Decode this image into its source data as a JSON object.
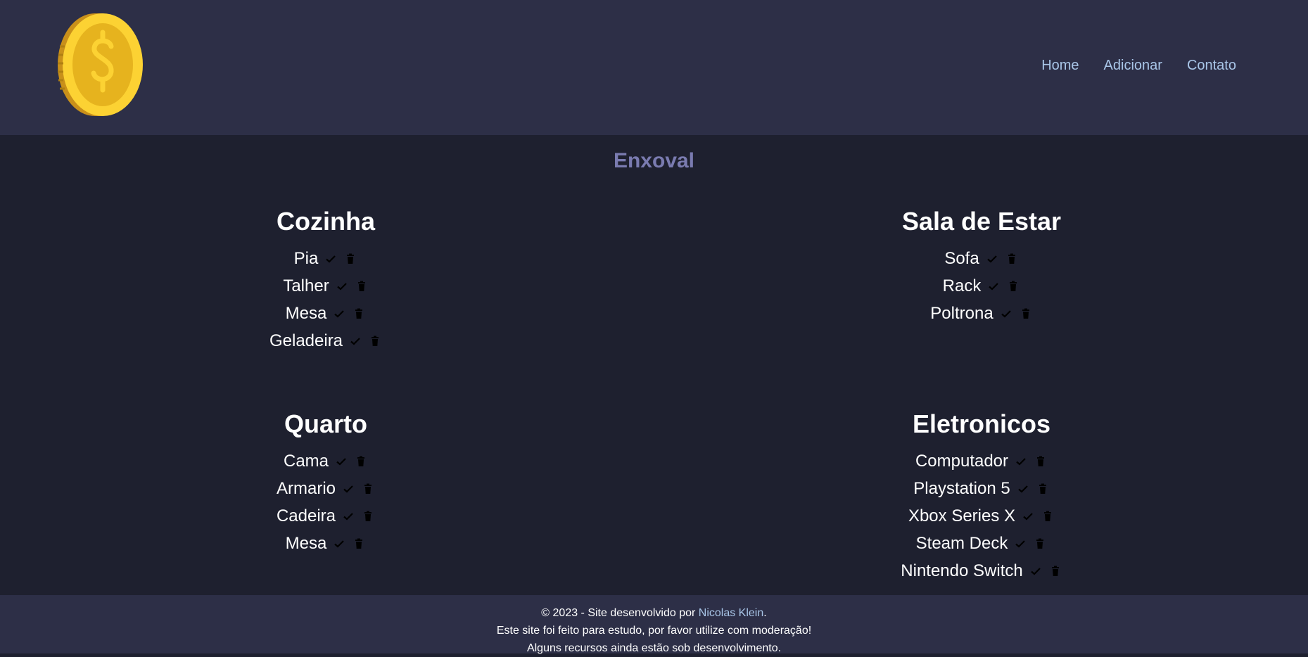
{
  "header": {
    "logo_icon": "coin-dollar-icon",
    "nav": [
      {
        "label": "Home"
      },
      {
        "label": "Adicionar"
      },
      {
        "label": "Contato"
      }
    ]
  },
  "main": {
    "title": "Enxoval",
    "categories": [
      {
        "name": "Cozinha",
        "items": [
          "Pia",
          "Talher",
          "Mesa",
          "Geladeira"
        ]
      },
      {
        "name": "Sala de Estar",
        "items": [
          "Sofa",
          "Rack",
          "Poltrona"
        ]
      },
      {
        "name": "Quarto",
        "items": [
          "Cama",
          "Armario",
          "Cadeira",
          "Mesa"
        ]
      },
      {
        "name": "Eletronicos",
        "items": [
          "Computador",
          "Playstation 5",
          "Xbox Series X",
          "Steam Deck",
          "Nintendo Switch"
        ]
      }
    ],
    "item_actions": {
      "check_icon": "check-icon",
      "delete_icon": "trash-icon"
    }
  },
  "footer": {
    "line1_prefix": "© 2023 - Site desenvolvido por ",
    "author": "Nicolas Klein",
    "line1_suffix": ".",
    "line2": "Este site foi feito para estudo, por favor utilize com moderação!",
    "line3": "Alguns recursos ainda estão sob desenvolvimento."
  },
  "colors": {
    "header_bg": "#2d2f47",
    "main_bg": "#1e202f",
    "title": "#7a7bb0",
    "link": "#a9c6e8",
    "coin": "#f5c518"
  }
}
